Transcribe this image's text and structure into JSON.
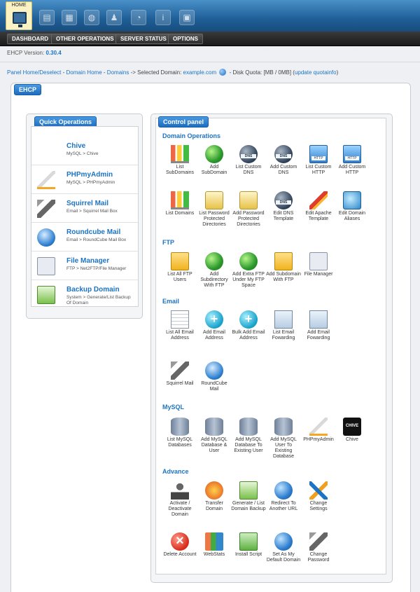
{
  "header": {
    "home_label": "HOME",
    "top_icons": [
      "domain-doc-icon",
      "server-icon",
      "network-globe-icon",
      "user-icon",
      "pie-chart-icon",
      "info-icon",
      "clipboard-icon"
    ]
  },
  "nav": {
    "dashboard": "DASHBOARD",
    "other": "OTHER OPERATIONS",
    "server_status": "SERVER STATUS",
    "options": "OPTIONS"
  },
  "version": {
    "label": "EHCP Version:",
    "value": "0.30.4"
  },
  "breadcrumb": {
    "panel_home": "Panel Home/Deselect",
    "sep1": "-",
    "domain_home": "Domain Home",
    "sep2": "-",
    "domains": "Domains",
    "selected_label": "-> Selected Domain:",
    "selected_domain": "example.com",
    "quota_text": "- Disk Quota: [MB / 0MB] (",
    "update_quota": "update quotainfo",
    "close_paren": ")"
  },
  "main_tab": "EHCP",
  "quick_ops": {
    "title": "Quick Operations",
    "items": [
      {
        "title": "Chive",
        "sub": "MySQL > Chive",
        "icon": "chive-icon"
      },
      {
        "title": "PHPmyAdmin",
        "sub": "MySQL > PHPmyAdmin",
        "icon": "phpmyadmin-icon"
      },
      {
        "title": "Squirrel Mail",
        "sub": "Email > Squirrel Mail Box",
        "icon": "squirrel-icon"
      },
      {
        "title": "Roundcube Mail",
        "sub": "Email > RoundCube Mail Box",
        "icon": "roundcube-icon"
      },
      {
        "title": "File Manager",
        "sub": "FTP > Net2FTP/File Manager",
        "icon": "file-manager-icon"
      },
      {
        "title": "Backup Domain",
        "sub": "System > Generate/List Backup Of Domain",
        "icon": "backup-icon"
      }
    ]
  },
  "control_panel": {
    "title": "Control panel",
    "sections": {
      "domain": {
        "heading": "Domain Operations",
        "items": [
          "List SubDomains",
          "Add SubDomain",
          "List Custom DNS",
          "Add Custom DNS",
          "List Custom HTTP",
          "Add Custom HTTP",
          "List Domains",
          "List Password Protected Directories",
          "Add Password Protected Directories",
          "Edit DNS Template",
          "Edit Apache Template",
          "Edit Domain Aliases"
        ]
      },
      "ftp": {
        "heading": "FTP",
        "items": [
          "List All FTP Users",
          "Add Subdirectory With FTP",
          "Add Extra FTP Under My FTP Space",
          "Add Subdomain With FTP",
          "File Manager"
        ]
      },
      "email": {
        "heading": "Email",
        "items": [
          "List All Email Address",
          "Add Email Address",
          "Bulk Add Email Address",
          "List Email Fowarding",
          "Add Email Fowarding",
          "Squirrel Mail",
          "RoundCube Mail"
        ]
      },
      "mysql": {
        "heading": "MySQL",
        "items": [
          "List MySQL Databases",
          "Add MySQL Database & User",
          "Add MySQL Database To Existing User",
          "Add MySQL User To Existing Database",
          "PHPmyAdmin",
          "Chive"
        ]
      },
      "advance": {
        "heading": "Advance",
        "items": [
          "Activate / Deactivate Domain",
          "Transfer Domain",
          "Generate / List Domain Backup",
          "Redirect To Another URL",
          "Change Settings",
          "Delete Account",
          "WebStats",
          "Install Script",
          "Set As My Default Domain",
          "Change Password"
        ]
      }
    }
  }
}
